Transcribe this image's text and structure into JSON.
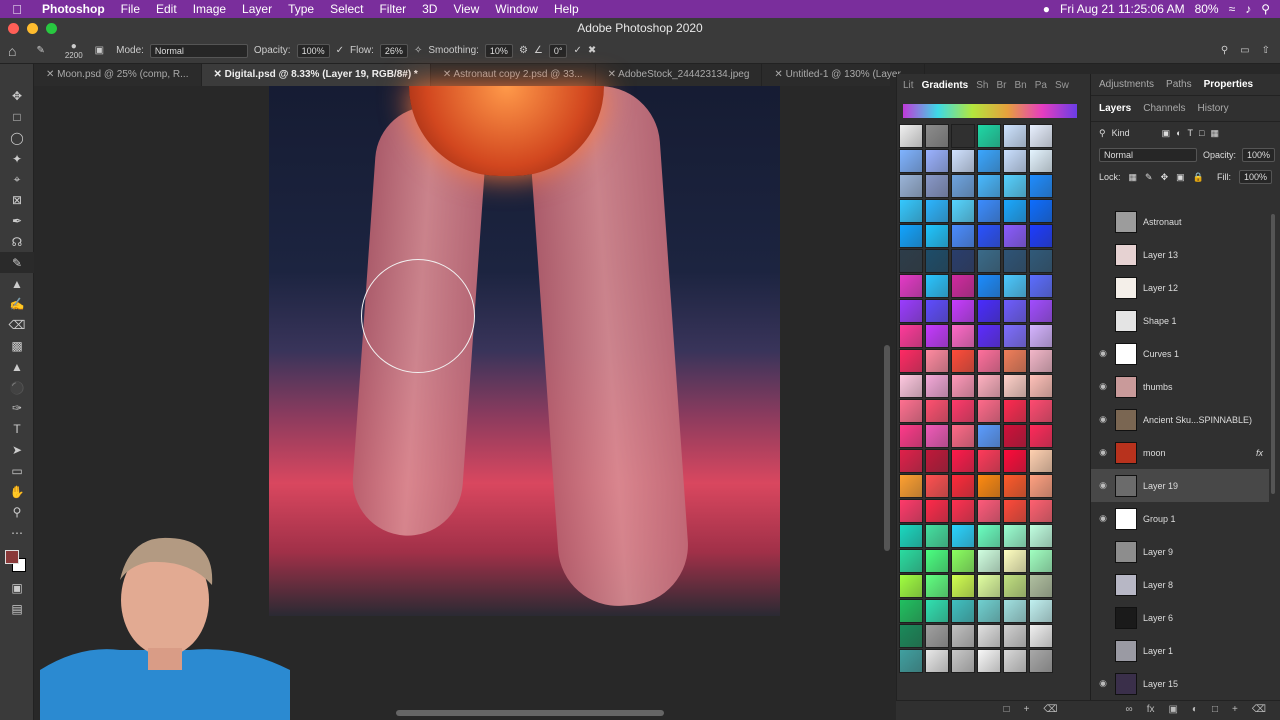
{
  "menubar": {
    "app": "Photoshop",
    "items": [
      "File",
      "Edit",
      "Image",
      "Layer",
      "Type",
      "Select",
      "Filter",
      "3D",
      "View",
      "Window",
      "Help"
    ],
    "datetime": "Fri Aug 21  11:25:06 AM",
    "battery": "80%"
  },
  "window": {
    "title": "Adobe Photoshop 2020"
  },
  "options": {
    "brush_size": "2200",
    "mode_label": "Mode:",
    "mode_value": "Normal",
    "opacity_label": "Opacity:",
    "opacity_value": "100%",
    "flow_label": "Flow:",
    "flow_value": "26%",
    "smoothing_label": "Smoothing:",
    "smoothing_value": "10%",
    "angle_value": "0°"
  },
  "doc_tabs": [
    {
      "label": "Moon.psd @ 25% (comp, R..."
    },
    {
      "label": "Digital.psd @ 8.33% (Layer 19, RGB/8#) *"
    },
    {
      "label": "Astronaut copy 2.psd @ 33..."
    },
    {
      "label": "AdobeStock_244423134.jpeg"
    },
    {
      "label": "Untitled-1 @ 130% (Layer ..."
    }
  ],
  "gradients_panel": {
    "tabs": [
      "Lit",
      "Gradients",
      "Sh",
      "Br",
      "Bn",
      "Pa",
      "Sw"
    ],
    "active": "Gradients"
  },
  "right_panel": {
    "top_tabs": [
      "Adjustments",
      "Paths",
      "Properties"
    ],
    "active_top": "Properties",
    "layer_tabs": [
      "Layers",
      "Channels",
      "History"
    ],
    "kind_label": "Kind",
    "blend_mode": "Normal",
    "opacity_label": "Opacity:",
    "opacity_value": "100%",
    "lock_label": "Lock:",
    "fill_label": "Fill:",
    "fill_value": "100%"
  },
  "layers": [
    {
      "name": "Astronaut",
      "visible": false,
      "color": "#9c9c9c"
    },
    {
      "name": "Layer 13",
      "visible": false,
      "color": "#e6d2d2"
    },
    {
      "name": "Layer 12",
      "visible": false,
      "color": "#f4efe9"
    },
    {
      "name": "Shape 1",
      "visible": false,
      "color": "#e4e4e4"
    },
    {
      "name": "Curves 1",
      "visible": true,
      "color": "#ffffff"
    },
    {
      "name": "thumbs",
      "visible": true,
      "color": "#c99a9a"
    },
    {
      "name": "Ancient Sku...SPINNABLE)",
      "visible": true,
      "color": "#7a6652"
    },
    {
      "name": "moon",
      "visible": true,
      "color": "#b8321d",
      "fx": "fx"
    },
    {
      "name": "Layer 19",
      "visible": true,
      "color": "#6b6b6b",
      "selected": true
    },
    {
      "name": "Group 1",
      "visible": true,
      "color": "#ffffff"
    },
    {
      "name": "Layer 9",
      "visible": false,
      "color": "#8d8d8d"
    },
    {
      "name": "Layer 8",
      "visible": false,
      "color": "#b7b7c5"
    },
    {
      "name": "Layer 6",
      "visible": false,
      "color": "#1a1a1a"
    },
    {
      "name": "Layer 1",
      "visible": false,
      "color": "#9a9aa3"
    },
    {
      "name": "Layer 15",
      "visible": true,
      "color": "#3a2f4a"
    }
  ],
  "colors": {
    "menubar": "#7a2e9c",
    "foreground": "#8a3a3a",
    "background": "#ffffff"
  }
}
